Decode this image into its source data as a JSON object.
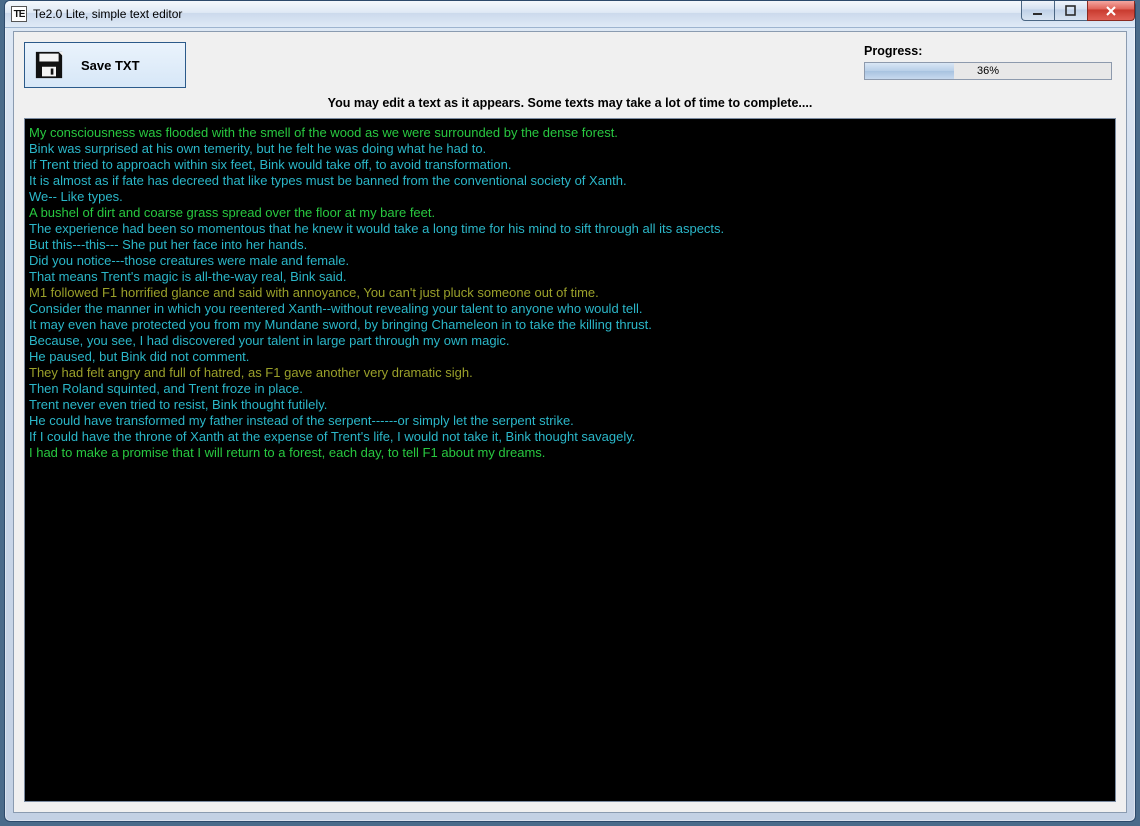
{
  "window": {
    "title": "Te2.0 Lite, simple text editor",
    "app_icon_text": "TE"
  },
  "toolbar": {
    "save_label": "Save TXT"
  },
  "progress": {
    "label": "Progress:",
    "percent": 36,
    "text": "36%"
  },
  "hint": "You may edit a text as it appears. Some texts may take a lot of time to complete....",
  "editor": {
    "lines": [
      {
        "color": "green",
        "text": "My consciousness was flooded with the smell of the wood as we were surrounded by the dense forest."
      },
      {
        "color": "teal",
        "text": "Bink was surprised at his own temerity, but he felt he was doing what he had to."
      },
      {
        "color": "teal",
        "text": "If Trent tried to approach within six feet, Bink would take off, to avoid transformation."
      },
      {
        "color": "teal",
        "text": "It is almost as if fate has decreed that like types must be banned from the conventional society of Xanth."
      },
      {
        "color": "teal",
        "text": "We-- Like types."
      },
      {
        "color": "green",
        "text": "A bushel of dirt and coarse grass spread over the floor at my bare feet."
      },
      {
        "color": "teal",
        "text": "The experience had been so momentous that he knew it would take a long time for his mind to sift through all its aspects."
      },
      {
        "color": "teal",
        "text": "But this---this--- She put her face into her hands."
      },
      {
        "color": "teal",
        "text": "Did you notice---those creatures were male and female."
      },
      {
        "color": "teal",
        "text": "That means Trent's magic is all-the-way real, Bink said."
      },
      {
        "color": "olive",
        "text": "M1 followed F1 horrified glance and said with annoyance, You can't just pluck someone out of time."
      },
      {
        "color": "teal",
        "text": "Consider the manner in which you reentered Xanth--without revealing your talent to anyone who would tell."
      },
      {
        "color": "teal",
        "text": "It may even have protected you from my Mundane sword, by bringing Chameleon in to take the killing thrust."
      },
      {
        "color": "teal",
        "text": "Because, you see, I had discovered your talent in large part through my own magic."
      },
      {
        "color": "teal",
        "text": "He paused, but Bink did not comment."
      },
      {
        "color": "olive",
        "text": "They had felt angry and full of hatred, as F1 gave another very dramatic sigh."
      },
      {
        "color": "teal",
        "text": "Then Roland squinted, and Trent froze in place."
      },
      {
        "color": "teal",
        "text": "Trent never even tried to resist, Bink thought futilely."
      },
      {
        "color": "teal",
        "text": "He could have transformed my father instead of the serpent------or simply let the serpent strike."
      },
      {
        "color": "teal",
        "text": "If I could have the throne of Xanth at the expense of Trent's life, I would not take it, Bink thought savagely."
      },
      {
        "color": "green",
        "text": "I had to make a promise that I will return to a forest, each day, to tell F1 about my dreams."
      }
    ]
  }
}
